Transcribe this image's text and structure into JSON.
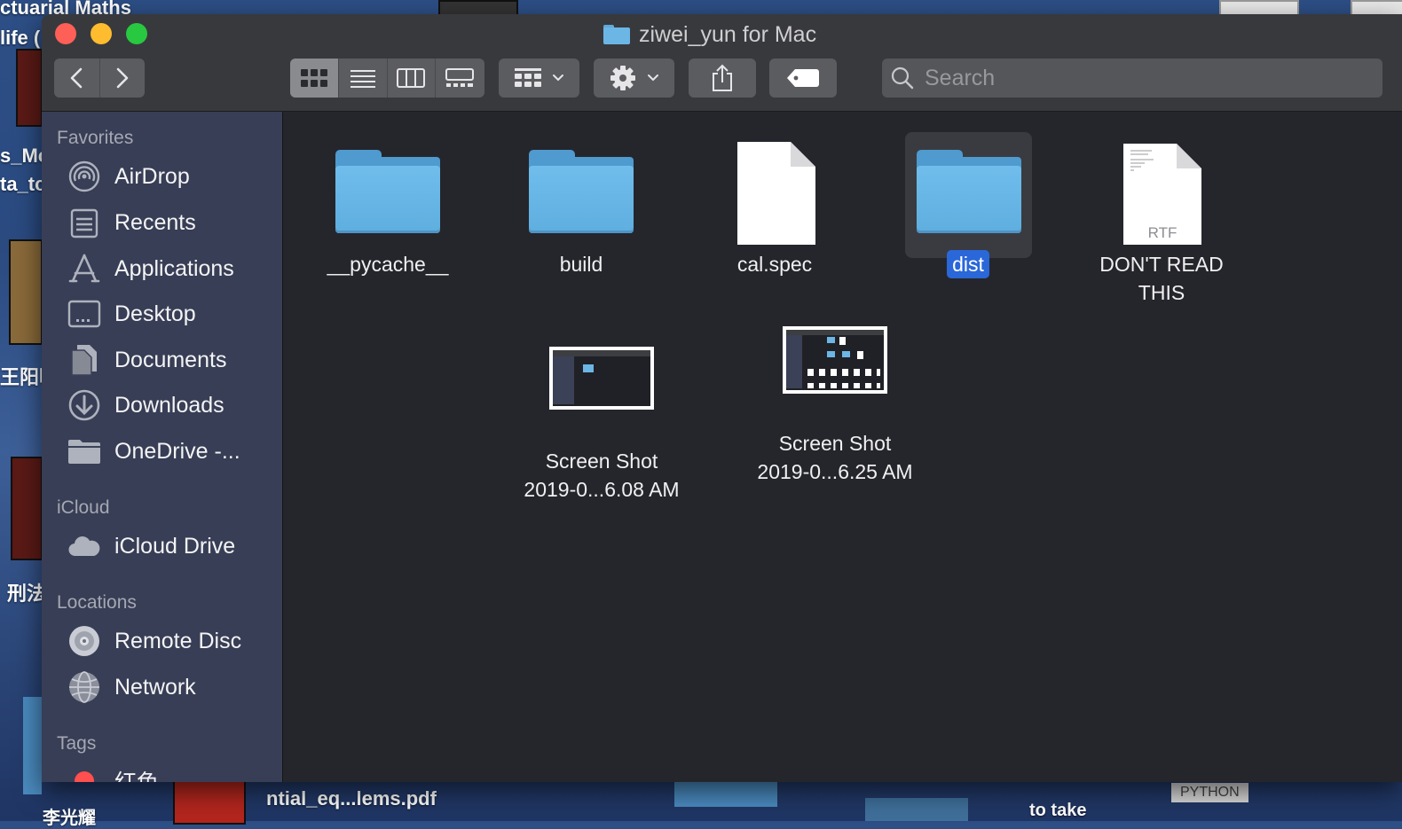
{
  "desktop": {
    "texts": [
      "ctuarial Maths",
      "life (",
      "s_Mc",
      "ta_tc",
      "王阳明",
      "刑法",
      "ntial_eq...lems.pdf",
      "to take",
      "李光耀"
    ],
    "badge": "PYTHON"
  },
  "window": {
    "title": "ziwei_yun for Mac"
  },
  "toolbar": {
    "search_placeholder": "Search",
    "icons": [
      "chevron-left-icon",
      "chevron-right-icon",
      "icon-view-icon",
      "list-view-icon",
      "column-view-icon",
      "gallery-view-icon",
      "group-by-icon",
      "gear-icon",
      "share-icon",
      "tag-icon",
      "search-icon"
    ]
  },
  "sidebar": {
    "favorites_header": "Favorites",
    "favorites": [
      {
        "label": "AirDrop",
        "icon": "airdrop-icon"
      },
      {
        "label": "Recents",
        "icon": "recents-icon"
      },
      {
        "label": "Applications",
        "icon": "applications-icon"
      },
      {
        "label": "Desktop",
        "icon": "desktop-icon"
      },
      {
        "label": "Documents",
        "icon": "documents-icon"
      },
      {
        "label": "Downloads",
        "icon": "downloads-icon"
      },
      {
        "label": "OneDrive -...",
        "icon": "folder-icon"
      }
    ],
    "icloud_header": "iCloud",
    "icloud": [
      {
        "label": "iCloud Drive",
        "icon": "cloud-icon"
      }
    ],
    "locations_header": "Locations",
    "locations": [
      {
        "label": "Remote Disc",
        "icon": "disc-icon"
      },
      {
        "label": "Network",
        "icon": "network-icon"
      }
    ],
    "tags_header": "Tags",
    "tags": [
      {
        "label": "红色",
        "color": "#ff4f4f"
      }
    ]
  },
  "files": [
    {
      "name": "__pycache__",
      "kind": "folder"
    },
    {
      "name": "build",
      "kind": "folder"
    },
    {
      "name": "cal.spec",
      "kind": "document"
    },
    {
      "name": "dist",
      "kind": "folder",
      "selected": true
    },
    {
      "name": "DON'T READ THIS",
      "kind": "rtf",
      "badge": "RTF"
    },
    {
      "name": "Screen Shot 2019-0...6.08 AM",
      "line1": "Screen Shot",
      "line2": "2019-0...6.08 AM",
      "kind": "screenshot"
    },
    {
      "name": "Screen Shot 2019-0...6.25 AM",
      "line1": "Screen Shot",
      "line2": "2019-0...6.25 AM",
      "kind": "screenshot"
    }
  ],
  "colors": {
    "selection": "#2a67d9",
    "close": "#fe5f57",
    "minimize": "#febc2e",
    "zoom": "#28c840",
    "folder": "#6cb6e6"
  }
}
